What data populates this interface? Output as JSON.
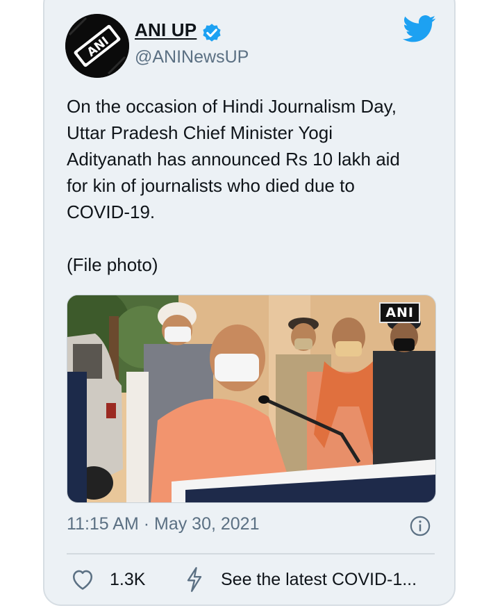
{
  "tweet": {
    "display_name": "ANI UP",
    "handle": "@ANINewsUP",
    "avatar_label": "ANI",
    "body": "On the occasion of Hindi Journalism Day,\nUttar Pradesh Chief Minister Yogi\nAdityanath has announced Rs 10 lakh aid\nfor kin of journalists who died due to\nCOVID-19.",
    "file_note": "(File photo)",
    "media_watermark": "ANI",
    "timestamp": "11:15 AM · May 30, 2021"
  },
  "actions": {
    "like_count": "1.3K",
    "covid_link": "See the latest COVID-1..."
  },
  "icons": {
    "avatar": "ani-logo-icon",
    "verified": "verified-badge-icon",
    "brand": "twitter-bird-icon",
    "info": "info-icon",
    "like": "heart-icon",
    "covid": "lightning-bolt-icon"
  },
  "colors": {
    "card_background": "#ecf1f5",
    "verified_blue": "#1da1f2",
    "twitter_blue": "#1da1f2",
    "secondary_text": "#5b7083",
    "primary_text": "#0f1419"
  }
}
